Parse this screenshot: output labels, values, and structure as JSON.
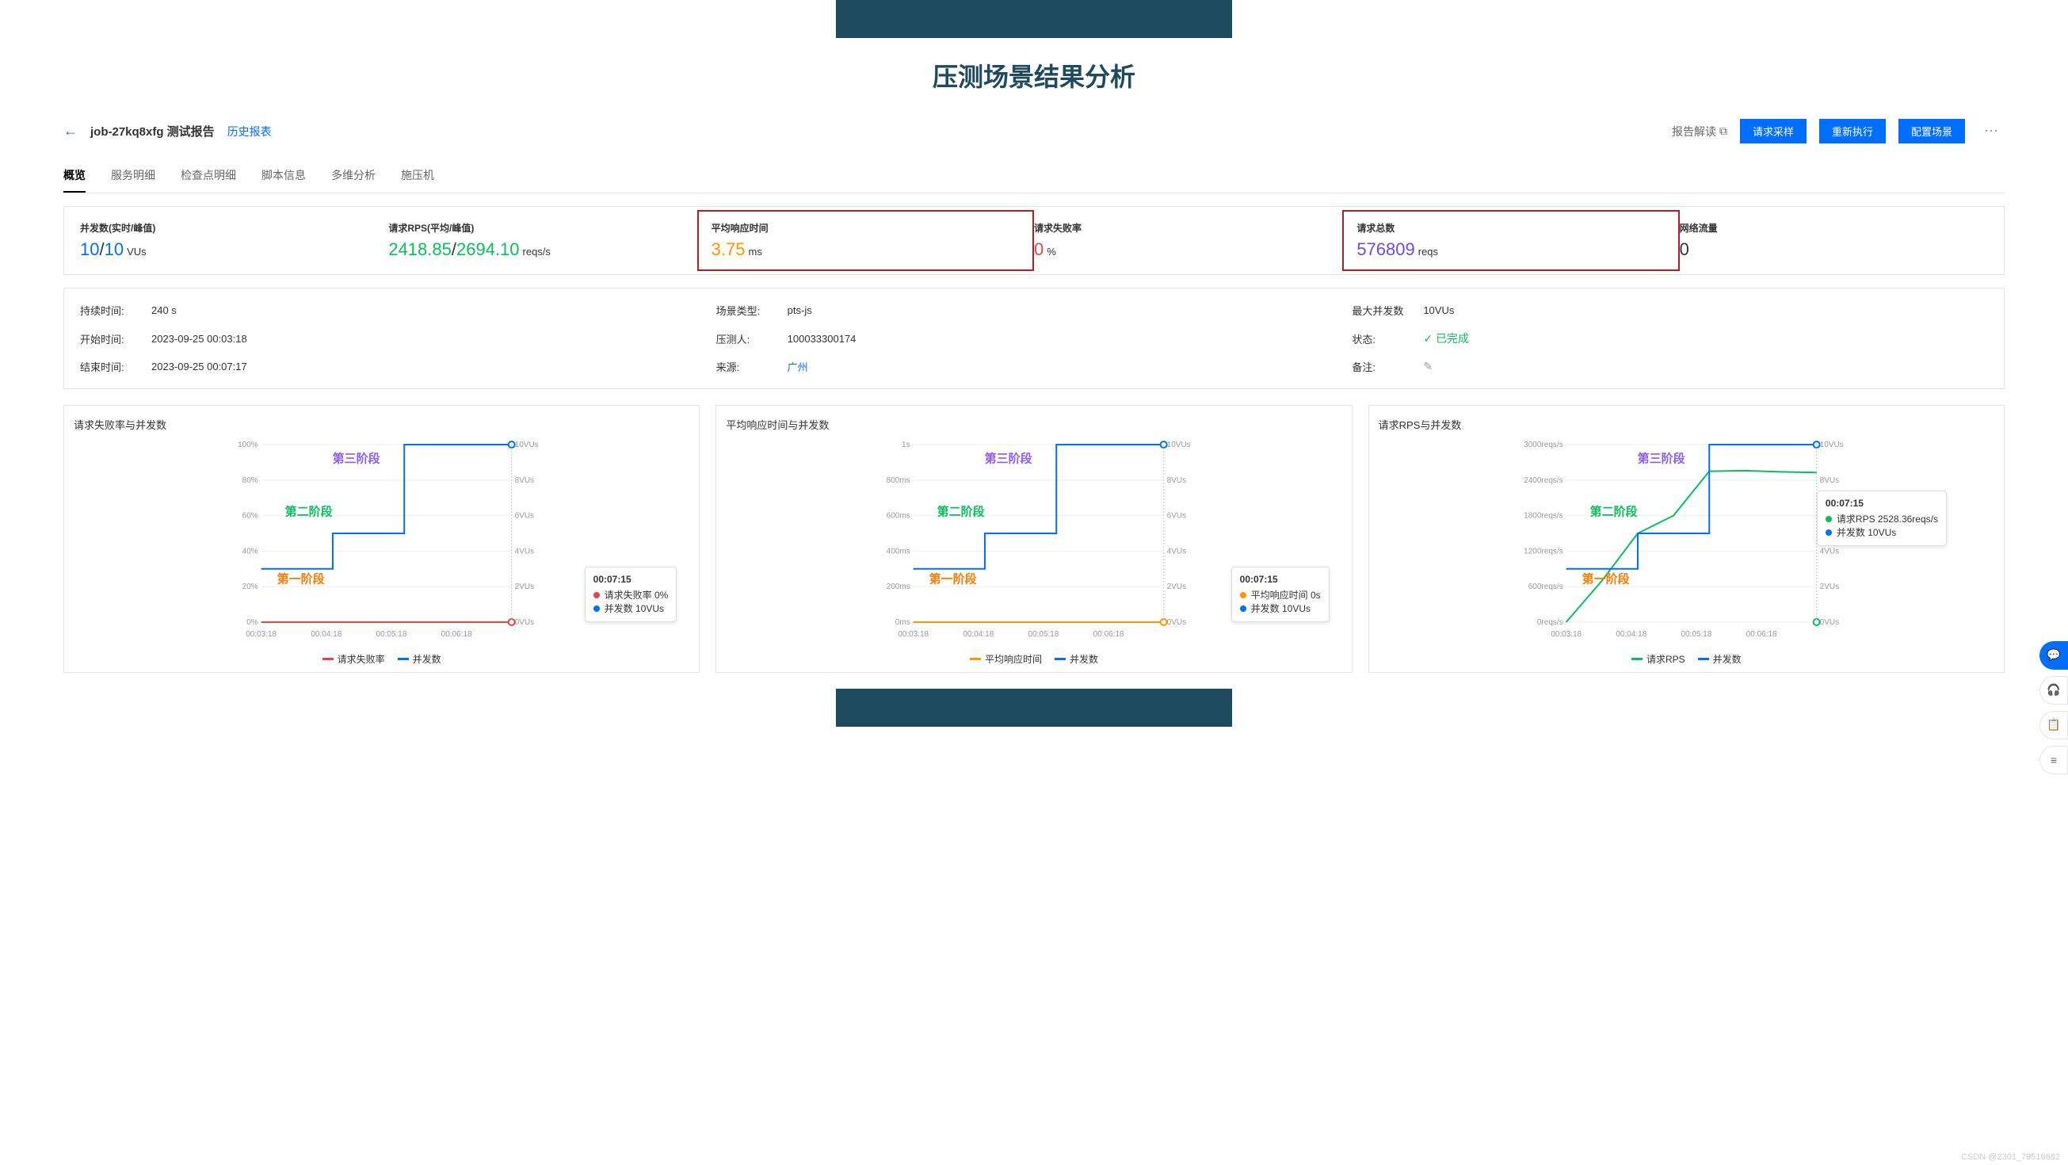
{
  "banner": {
    "title": "压测场景结果分析"
  },
  "header": {
    "job_title": "job-27kq8xfg 测试报告",
    "history_link": "历史报表",
    "report_interp": "报告解读",
    "btn_sample": "请求采样",
    "btn_rerun": "重新执行",
    "btn_config": "配置场景"
  },
  "tabs": [
    "概览",
    "服务明细",
    "检查点明细",
    "脚本信息",
    "多维分析",
    "施压机"
  ],
  "active_tab": 0,
  "metrics": {
    "vu": {
      "label": "并发数(实时/峰值)",
      "realtime": "10",
      "peak": "10",
      "unit": "VUs"
    },
    "rps": {
      "label": "请求RPS(平均/峰值)",
      "avg": "2418.85",
      "peak": "2694.10",
      "unit": "reqs/s"
    },
    "avg_resp": {
      "label": "平均响应时间",
      "value": "3.75",
      "unit": "ms"
    },
    "fail_rate": {
      "label": "请求失败率",
      "value": "0",
      "unit": "%"
    },
    "total_req": {
      "label": "请求总数",
      "value": "576809",
      "unit": "reqs"
    },
    "net": {
      "label": "网络流量",
      "value": "0"
    }
  },
  "info": {
    "duration": {
      "label": "持续时间:",
      "value": "240 s"
    },
    "scene_type": {
      "label": "场景类型:",
      "value": "pts-js"
    },
    "max_vu": {
      "label": "最大并发数",
      "value": "10VUs"
    },
    "start_time": {
      "label": "开始时间:",
      "value": "2023-09-25 00:03:18"
    },
    "tester": {
      "label": "压测人:",
      "value": "100033300174"
    },
    "status": {
      "label": "状态:",
      "value": "已完成"
    },
    "end_time": {
      "label": "结束时间:",
      "value": "2023-09-25 00:07:17"
    },
    "source": {
      "label": "来源:",
      "value": "广州"
    },
    "remark": {
      "label": "备注:"
    }
  },
  "annotations": {
    "stage1": "第一阶段",
    "stage2": "第二阶段",
    "stage3": "第三阶段"
  },
  "chart_data": [
    {
      "type": "line",
      "title": "请求失败率与并发数",
      "x_ticks": [
        "00:03:18",
        "00:04:18",
        "00:05:18",
        "00:06:18"
      ],
      "left_axis": {
        "label": "%",
        "ticks": [
          "0%",
          "20%",
          "40%",
          "60%",
          "80%",
          "100%"
        ]
      },
      "right_axis": {
        "label": "VUs",
        "ticks": [
          "0VUs",
          "2VUs",
          "4VUs",
          "6VUs",
          "8VUs",
          "10VUs"
        ]
      },
      "series": [
        {
          "name": "请求失败率",
          "color": "#e54545",
          "values": [
            0,
            0,
            0,
            0,
            0,
            0,
            0,
            0
          ]
        },
        {
          "name": "并发数",
          "color": "#006eff",
          "values": [
            3,
            3,
            5,
            5,
            10,
            10,
            10,
            10
          ]
        }
      ],
      "tooltip": {
        "time": "00:07:15",
        "rows": [
          {
            "k": "请求失败率",
            "v": "0%",
            "c": "#e54545"
          },
          {
            "k": "并发数",
            "v": "10VUs",
            "c": "#006eff"
          }
        ]
      }
    },
    {
      "type": "line",
      "title": "平均响应时间与并发数",
      "x_ticks": [
        "00:03:18",
        "00:04:18",
        "00:05:18",
        "00:06:18"
      ],
      "left_axis": {
        "label": "ms",
        "ticks": [
          "0ms",
          "200ms",
          "400ms",
          "600ms",
          "800ms",
          "1s"
        ]
      },
      "right_axis": {
        "label": "VUs",
        "ticks": [
          "0VUs",
          "2VUs",
          "4VUs",
          "6VUs",
          "8VUs",
          "10VUs"
        ]
      },
      "series": [
        {
          "name": "平均响应时间",
          "color": "#ff9500",
          "values": [
            0,
            0,
            0,
            0,
            0,
            0,
            0,
            0
          ]
        },
        {
          "name": "并发数",
          "color": "#006eff",
          "values": [
            3,
            3,
            5,
            5,
            10,
            10,
            10,
            10
          ]
        }
      ],
      "tooltip": {
        "time": "00:07:15",
        "rows": [
          {
            "k": "平均响应时间",
            "v": "0s",
            "c": "#ff9500"
          },
          {
            "k": "并发数",
            "v": "10VUs",
            "c": "#006eff"
          }
        ]
      }
    },
    {
      "type": "line",
      "title": "请求RPS与并发数",
      "x_ticks": [
        "00:03:18",
        "00:04:18",
        "00:05:18",
        "00:06:18"
      ],
      "left_axis": {
        "label": "reqs/s",
        "ticks": [
          "0reqs/s",
          "600reqs/s",
          "1200reqs/s",
          "1800reqs/s",
          "2400reqs/s",
          "3000reqs/s"
        ]
      },
      "right_axis": {
        "label": "VUs",
        "ticks": [
          "0VUs",
          "2VUs",
          "4VUs",
          "6VUs",
          "8VUs",
          "10VUs"
        ]
      },
      "series": [
        {
          "name": "请求RPS",
          "color": "#0abf5b",
          "values": [
            0,
            700,
            1500,
            1800,
            2550,
            2560,
            2540,
            2528
          ]
        },
        {
          "name": "并发数",
          "color": "#006eff",
          "values": [
            3,
            3,
            5,
            5,
            10,
            10,
            10,
            10
          ]
        }
      ],
      "tooltip": {
        "time": "00:07:15",
        "rows": [
          {
            "k": "请求RPS",
            "v": "2528.36reqs/s",
            "c": "#0abf5b"
          },
          {
            "k": "并发数",
            "v": "10VUs",
            "c": "#006eff"
          }
        ]
      }
    }
  ],
  "watermark": "CSDN @2301_79516682"
}
